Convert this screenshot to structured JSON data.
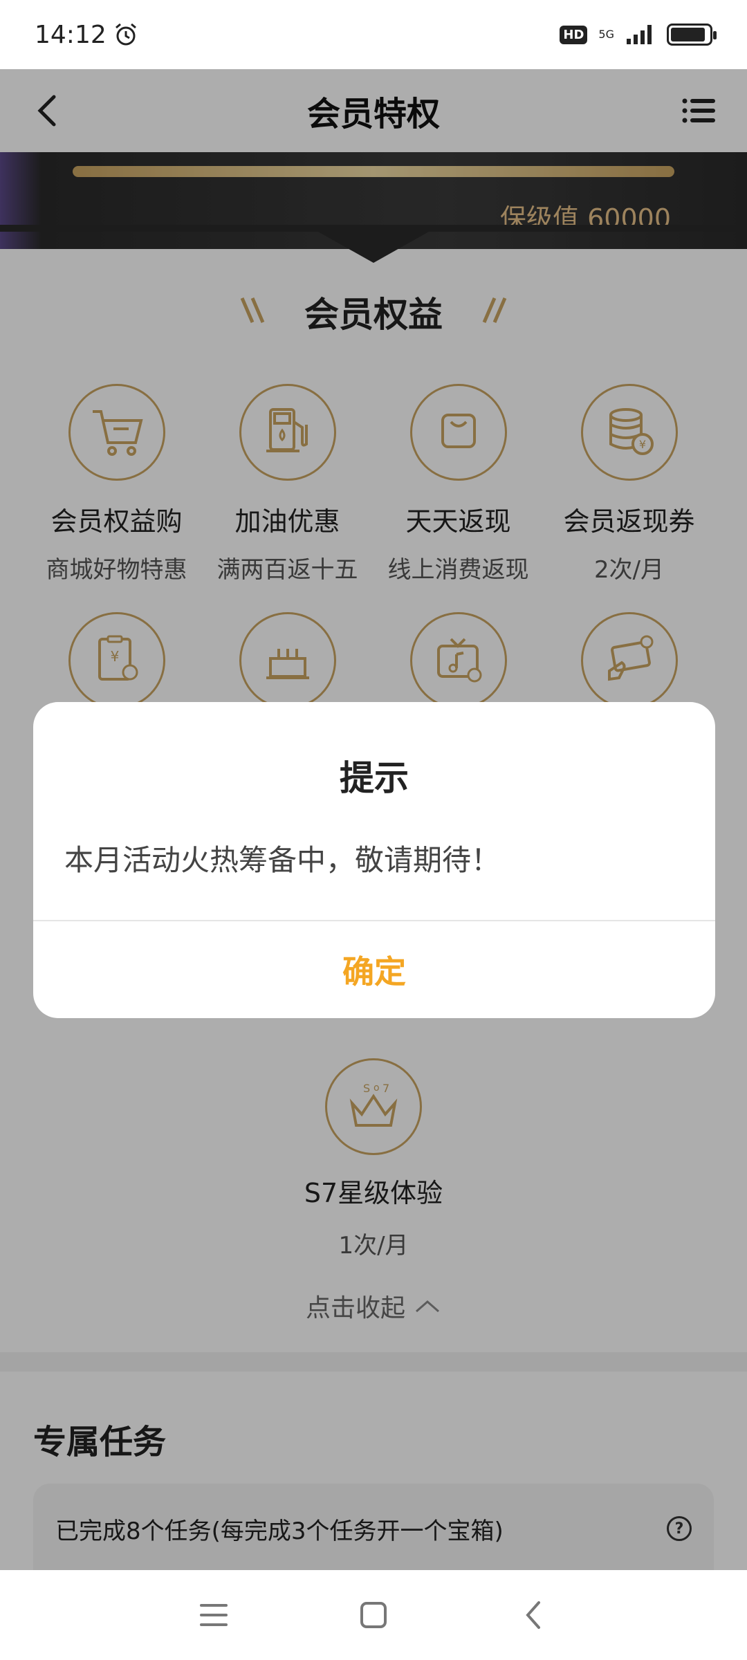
{
  "status_bar": {
    "time": "14:12",
    "hd": "HD",
    "network": "5G"
  },
  "header": {
    "title": "会员特权"
  },
  "hero": {
    "level_value": "保级值 60000"
  },
  "benefits_section": {
    "title": "会员权益",
    "items": [
      {
        "name": "会员权益购",
        "desc": "商城好物特惠",
        "icon": "cart-icon"
      },
      {
        "name": "加油优惠",
        "desc": "满两百返十五",
        "icon": "fuel-pump-icon"
      },
      {
        "name": "天天返现",
        "desc": "线上消费返现",
        "icon": "shopping-bag-icon"
      },
      {
        "name": "会员返现券",
        "desc": "2次/月",
        "icon": "coin-stack-icon"
      },
      {
        "name": "",
        "desc": "",
        "icon": "bill-icon"
      },
      {
        "name": "",
        "desc": "",
        "icon": "birthday-cake-icon"
      },
      {
        "name": "",
        "desc": "",
        "icon": "music-tv-icon"
      },
      {
        "name": "",
        "desc": "",
        "icon": "card-hand-icon"
      }
    ],
    "s7": {
      "name": "S7星级体验",
      "desc": "1次/月",
      "icon": "crown-icon"
    },
    "collapse_label": "点击收起"
  },
  "tasks": {
    "title": "专属任务",
    "progress_text": "已完成8个任务(每完成3个任务开一个宝箱)"
  },
  "dialog": {
    "title": "提示",
    "message": "本月活动火热筹备中，敬请期待！",
    "confirm_label": "确定"
  },
  "colors": {
    "accent": "#F4A623",
    "gold": "#C9A462",
    "overlay": "rgba(0,0,0,0.32)"
  }
}
